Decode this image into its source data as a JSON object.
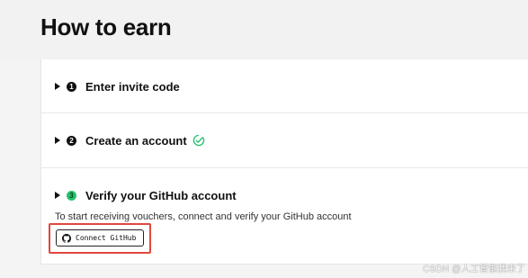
{
  "page": {
    "title": "How to earn"
  },
  "steps": [
    {
      "number": "1",
      "label": "Enter invite code",
      "completed": false
    },
    {
      "number": "2",
      "label": "Create an account",
      "completed": true
    },
    {
      "number": "3",
      "label": "Verify your GitHub account",
      "active": true,
      "description": "To start receiving vouchers, connect and verify your GitHub account",
      "button_label": "Connect GitHub"
    }
  ],
  "icons": {
    "expand": "caret-right-icon",
    "completed": "check-circle-icon",
    "github": "github-icon"
  },
  "colors": {
    "active_step": "#25c26e",
    "completed_check": "#25c26e",
    "highlight_box": "#e0473d"
  },
  "watermark": "CSDN @人工智能我来了"
}
